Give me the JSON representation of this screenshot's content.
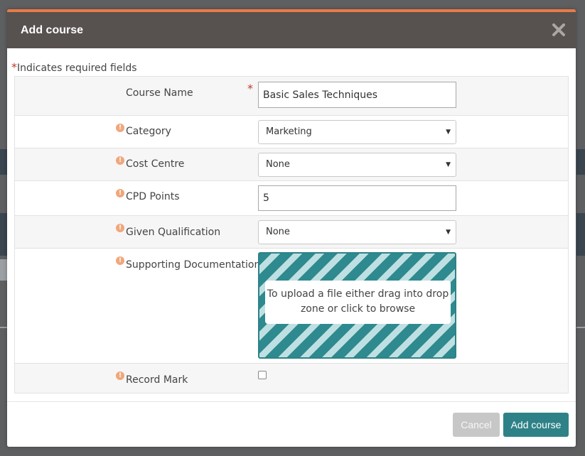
{
  "modal": {
    "title": "Add course",
    "required_star": "*",
    "required_note": "Indicates required fields"
  },
  "form": {
    "course_name": {
      "label": "Course Name",
      "required": "*",
      "value": "Basic Sales Techniques"
    },
    "category": {
      "label": "Category",
      "value": "Marketing"
    },
    "cost_centre": {
      "label": "Cost Centre",
      "value": "None"
    },
    "cpd_points": {
      "label": "CPD Points",
      "value": "5"
    },
    "given_qualification": {
      "label": "Given Qualification",
      "value": "None"
    },
    "supporting_documentation": {
      "label": "Supporting Documentation",
      "dropzone_text": "To upload a file either drag into drop zone or click to browse"
    },
    "record_mark": {
      "label": "Record Mark",
      "checked": false
    }
  },
  "footer": {
    "cancel_label": "Cancel",
    "add_label": "Add course"
  },
  "colors": {
    "header_bg": "#575250",
    "header_accent": "#ea7a46",
    "primary": "#2e8287",
    "info_icon": "#f0a77c",
    "required": "#c0392b"
  },
  "icons": {
    "close": "close-icon",
    "info": "info-icon",
    "caret": "caret-down-icon"
  },
  "caret_glyph": "▼",
  "info_glyph": "!"
}
